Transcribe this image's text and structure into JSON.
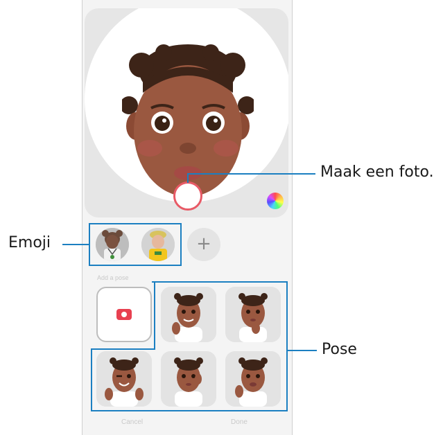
{
  "callouts": {
    "capture": "Maak een foto.",
    "emoji": "Emoji",
    "pose": "Pose"
  },
  "emoji_strip": {
    "add_label": "+"
  },
  "poses": {
    "section_label": "Add a pose"
  },
  "footer": {
    "cancel": "Cancel",
    "done": "Done"
  },
  "colors": {
    "accent": "#1b7fc1",
    "shutter_ring": "#e85a66",
    "camera_icon": "#e84050"
  }
}
